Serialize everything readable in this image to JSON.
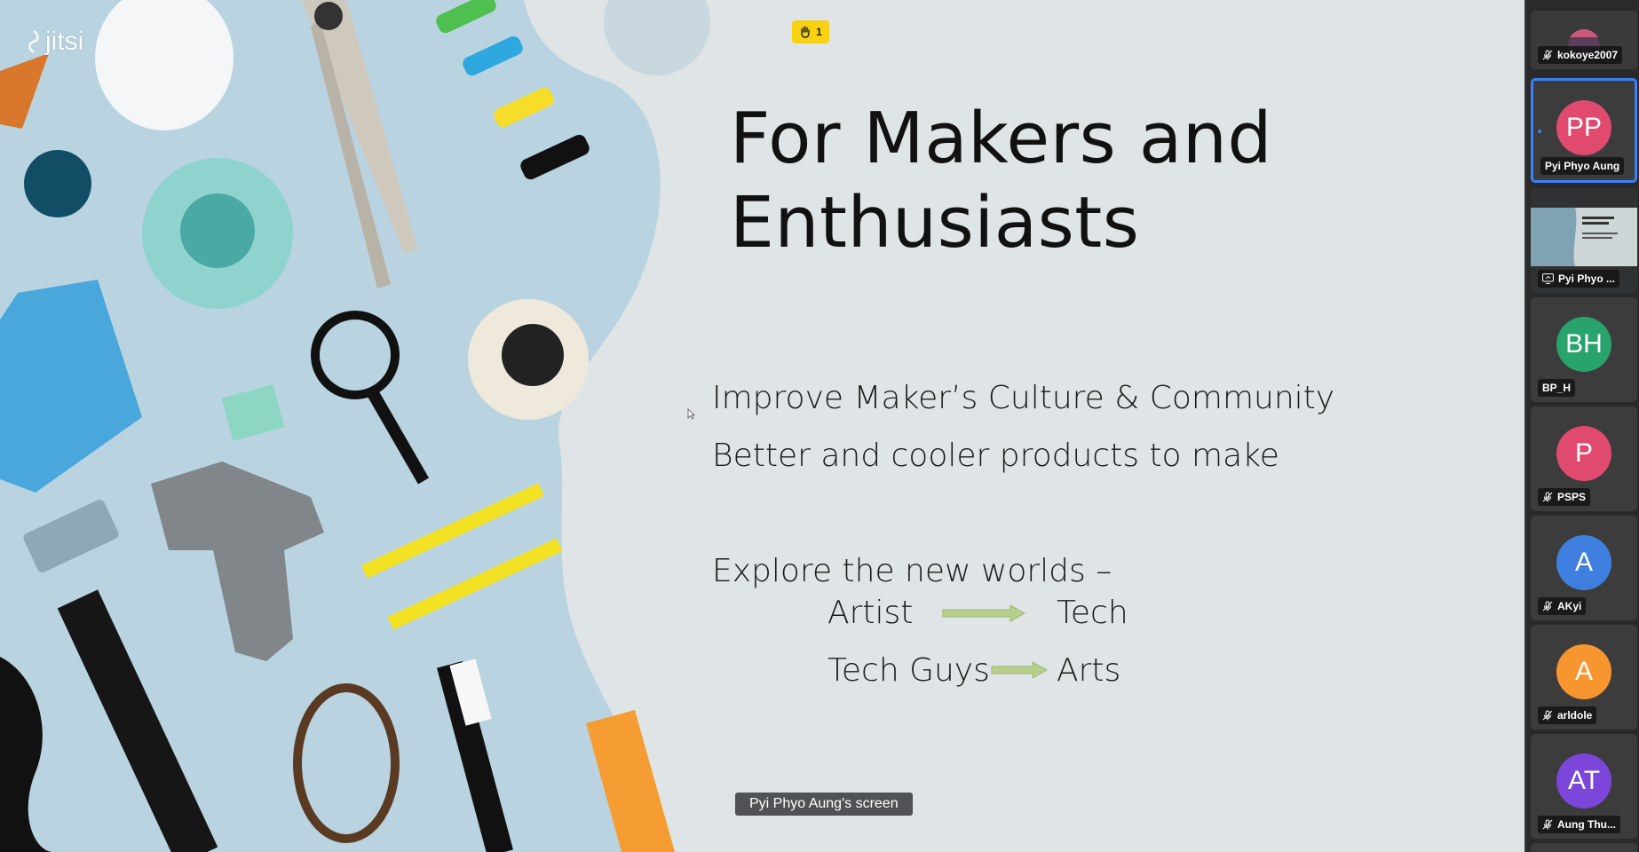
{
  "app": {
    "logo_text": "jitsi"
  },
  "raised_hands": {
    "count": "1",
    "icon": "raised-hand-icon",
    "color": "#f8d212"
  },
  "slide": {
    "title_line1": "For Makers and",
    "title_line2": "Enthusiasts",
    "bullet1": "Improve Maker’s Culture & Community",
    "bullet2": "Better and cooler products to make",
    "explore": "Explore the new worlds –",
    "row1_left": "Artist",
    "row1_right": "Tech",
    "row2_left": "Tech Guys",
    "row2_right": "Arts",
    "arrow_color": "#b7cf8a"
  },
  "screen_label": "Pyi Phyo Aung's screen",
  "participants": [
    {
      "name": "kokoye2007",
      "type": "video",
      "muted": true
    },
    {
      "name": "Pyi Phyo Aung",
      "initials": "PP",
      "color": "#e04a6e",
      "muted": false,
      "active": true
    },
    {
      "name": "Pyi Phyo ...",
      "type": "screenshare"
    },
    {
      "name": "BP_H",
      "initials": "BH",
      "color": "#27a36b",
      "muted": false
    },
    {
      "name": "PSPS",
      "initials": "P",
      "color": "#e04a6e",
      "muted": true
    },
    {
      "name": "AKyi",
      "initials": "A",
      "color": "#3f7fe0",
      "muted": true
    },
    {
      "name": "arldole",
      "initials": "A",
      "color": "#f7962f",
      "muted": true
    },
    {
      "name": "Aung Thu...",
      "initials": "AT",
      "color": "#7b46d9",
      "muted": true
    }
  ]
}
